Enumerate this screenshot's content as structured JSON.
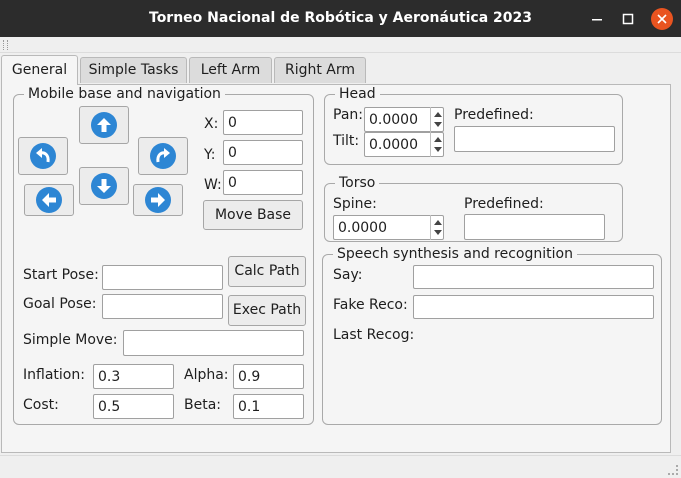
{
  "window": {
    "title": "Torneo Nacional de Robótica y Aeronáutica 2023",
    "controls": {
      "minimize": "–",
      "maximize": "□",
      "close": "✕"
    }
  },
  "tabs": [
    {
      "label": "General",
      "active": true
    },
    {
      "label": "Simple Tasks",
      "active": false
    },
    {
      "label": "Left Arm",
      "active": false
    },
    {
      "label": "Right Arm",
      "active": false
    }
  ],
  "mobile_base": {
    "title": "Mobile base and navigation",
    "icons": {
      "up": "arrow-up-icon",
      "down": "arrow-down-icon",
      "left": "arrow-left-icon",
      "right": "arrow-right-icon",
      "turn_left": "rotate-left-icon",
      "turn_right": "rotate-right-icon"
    },
    "x_label": "X:",
    "x_value": "0",
    "y_label": "Y:",
    "y_value": "0",
    "w_label": "W:",
    "w_value": "0",
    "move_base_label": "Move Base",
    "start_pose_label": "Start Pose:",
    "start_pose_value": "",
    "goal_pose_label": "Goal Pose:",
    "goal_pose_value": "",
    "calc_path_label": "Calc Path",
    "exec_path_label": "Exec Path",
    "simple_move_label": "Simple Move:",
    "simple_move_value": "",
    "inflation_label": "Inflation:",
    "inflation_value": "0.3",
    "alpha_label": "Alpha:",
    "alpha_value": "0.9",
    "cost_label": "Cost:",
    "cost_value": "0.5",
    "beta_label": "Beta:",
    "beta_value": "0.1"
  },
  "head": {
    "title": "Head",
    "pan_label": "Pan:",
    "pan_value": "0.0000",
    "tilt_label": "Tilt:",
    "tilt_value": "0.0000",
    "predefined_label": "Predefined:",
    "predefined_value": ""
  },
  "torso": {
    "title": "Torso",
    "spine_label": "Spine:",
    "spine_value": "0.0000",
    "predefined_label": "Predefined:",
    "predefined_value": ""
  },
  "speech": {
    "title": "Speech synthesis and recognition",
    "say_label": "Say:",
    "say_value": "",
    "fake_reco_label": "Fake Reco:",
    "fake_reco_value": "",
    "last_recog_label": "Last Recog:"
  },
  "colors": {
    "accent": "#2d86d4",
    "titlebar": "#2c2c2c",
    "close": "#e95420"
  }
}
